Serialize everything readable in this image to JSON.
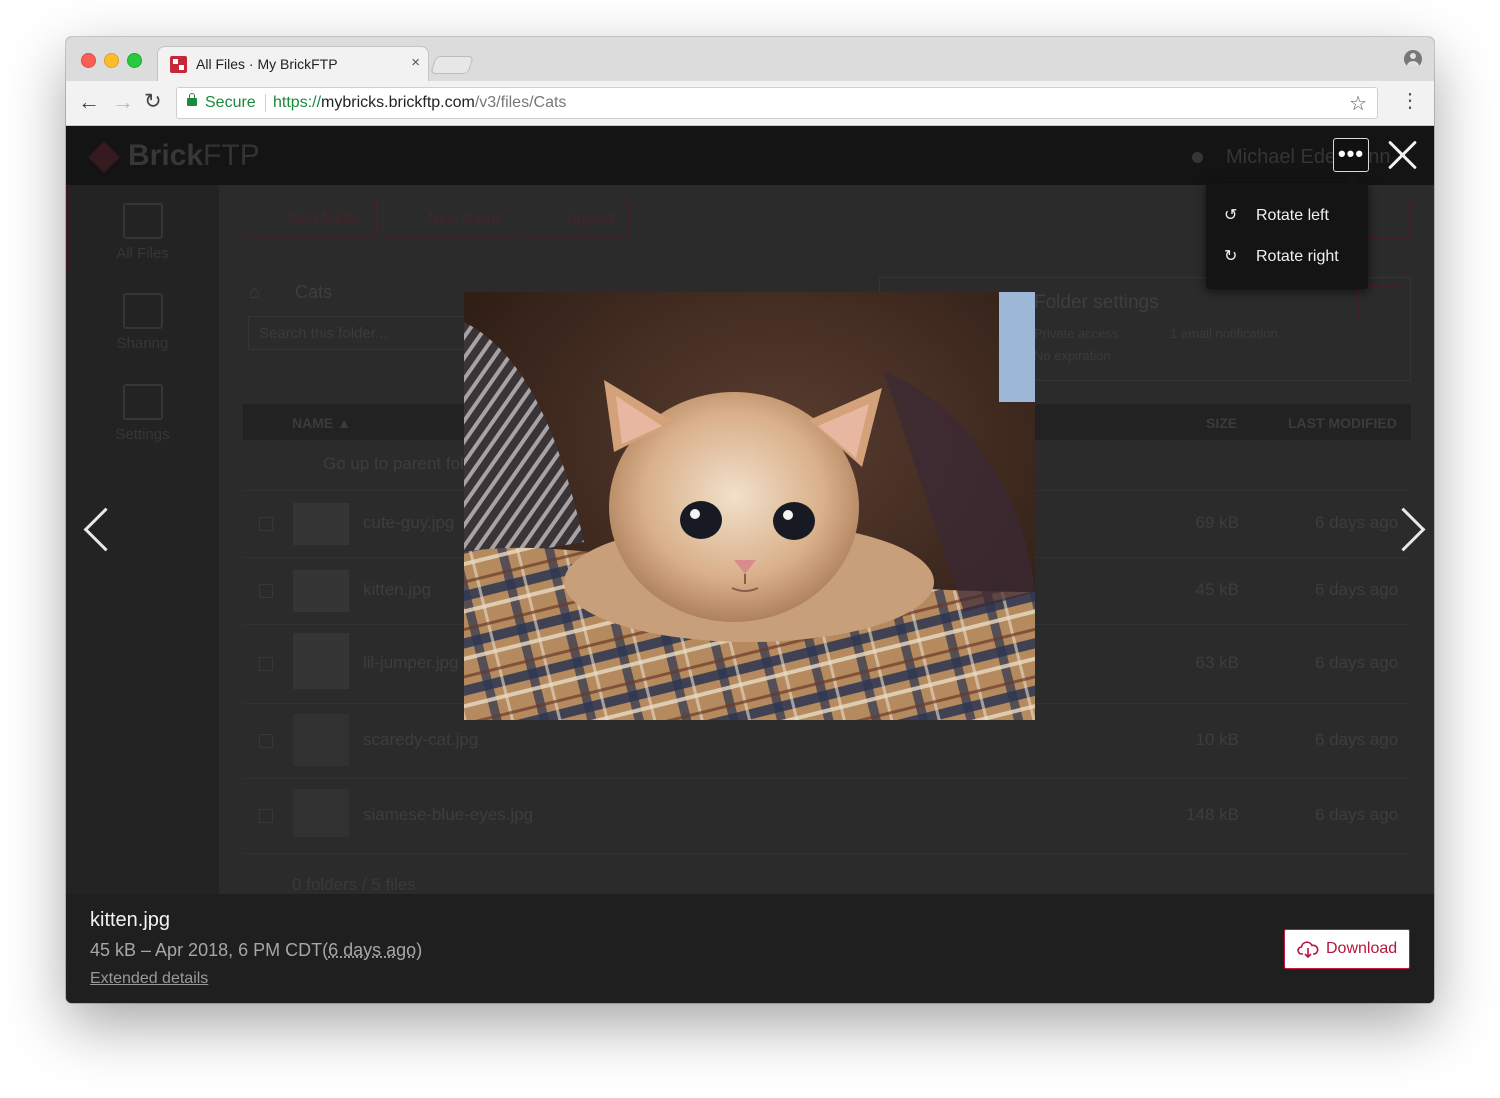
{
  "browser": {
    "tab_title": "All Files · My BrickFTP",
    "tab_close": "×",
    "secure_label": "Secure",
    "url_scheme": "https://",
    "url_host": "mybricks.brickftp.com",
    "url_path": "/v3/files/Cats"
  },
  "app": {
    "brand_name": "Brick",
    "brand_suffix": "FTP",
    "user_name": "Michael Edelmann",
    "sidebar": [
      {
        "label": "All Files"
      },
      {
        "label": "Sharing"
      },
      {
        "label": "Settings"
      }
    ],
    "toolbar": {
      "new_folder": "New folder",
      "new_share": "New share",
      "upload": "Upload"
    },
    "breadcrumb": "Cats",
    "search_placeholder": "Search this folder...",
    "folder_settings": {
      "title": "Folder settings",
      "line1": "Private access",
      "line2": "No expiration",
      "notification": "1 email notification"
    },
    "table": {
      "col_name": "NAME ▲",
      "col_size": "SIZE",
      "col_modified": "LAST MODIFIED",
      "parent_row": "Go up to parent folder",
      "rows": [
        {
          "name": "cute-guy.jpg",
          "size": "69 kB",
          "modified": "6 days ago"
        },
        {
          "name": "kitten.jpg",
          "size": "45 kB",
          "modified": "6 days ago"
        },
        {
          "name": "lil-jumper.jpg",
          "size": "63 kB",
          "modified": "6 days ago"
        },
        {
          "name": "scaredy-cat.jpg",
          "size": "10 kB",
          "modified": "6 days ago"
        },
        {
          "name": "siamese-blue-eyes.jpg",
          "size": "148 kB",
          "modified": "6 days ago"
        }
      ],
      "summary": "0 folders / 5 files"
    }
  },
  "viewer": {
    "menu": {
      "more_dots": "•••",
      "rotate_left": "Rotate left",
      "rotate_right": "Rotate right"
    },
    "file_name": "kitten.jpg",
    "meta_prefix": "45 kB – Apr 2018, 6 PM CDT(",
    "meta_relative": "6 days ago",
    "meta_suffix": ")",
    "extended_details": "Extended details",
    "download": "Download"
  },
  "colors": {
    "accent": "#c7193e",
    "secure_green": "#1a8a3c"
  }
}
